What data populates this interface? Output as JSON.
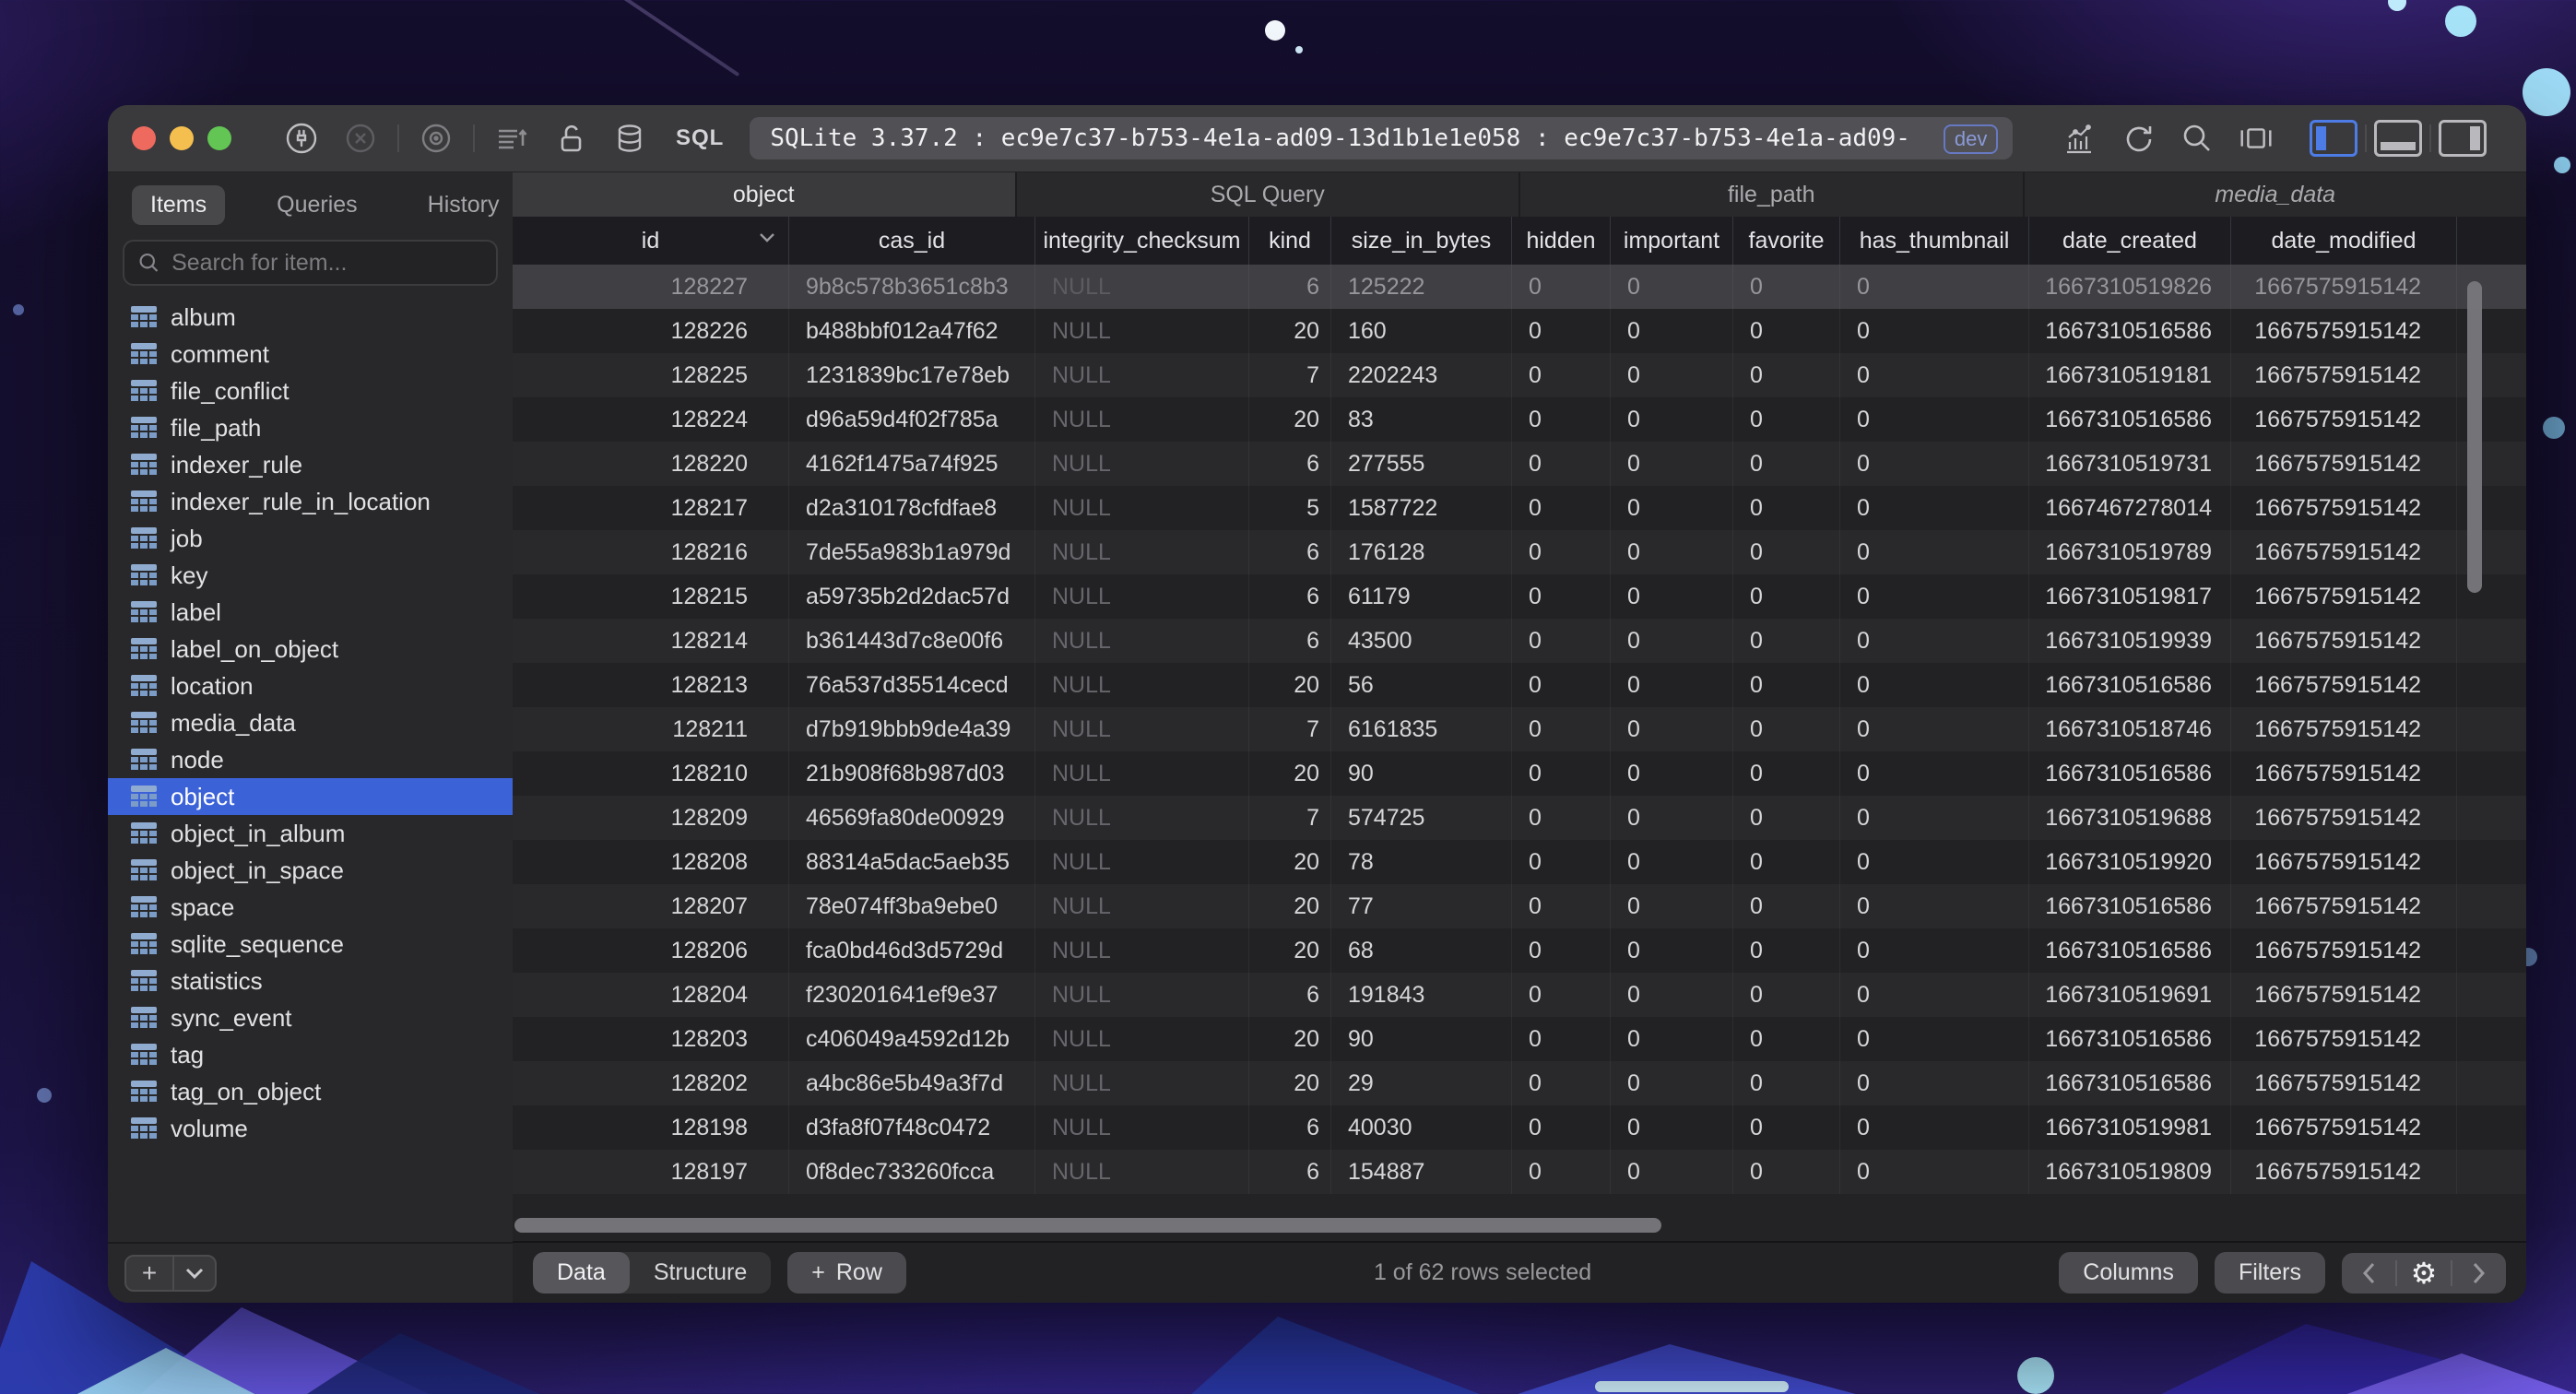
{
  "window": {
    "title": "SQLite 3.37.2 : ec9e7c37-b753-4e1a-ad09-13d1b1e1e058 : ec9e7c37-b753-4e1a-ad09-",
    "dev_badge": "dev",
    "sql_label": "SQL"
  },
  "icons": {
    "plus": "+",
    "gear": "⚙"
  },
  "sidebar": {
    "tabs": [
      {
        "label": "Items",
        "active": true
      },
      {
        "label": "Queries",
        "active": false
      },
      {
        "label": "History",
        "active": false
      }
    ],
    "search_placeholder": "Search for item...",
    "selected_item": "object",
    "items": [
      "album",
      "comment",
      "file_conflict",
      "file_path",
      "indexer_rule",
      "indexer_rule_in_location",
      "job",
      "key",
      "label",
      "label_on_object",
      "location",
      "media_data",
      "node",
      "object",
      "object_in_album",
      "object_in_space",
      "space",
      "sqlite_sequence",
      "statistics",
      "sync_event",
      "tag",
      "tag_on_object",
      "volume"
    ]
  },
  "main": {
    "tabs": [
      {
        "label": "object",
        "active": true,
        "italic": false
      },
      {
        "label": "SQL Query",
        "active": false,
        "italic": false
      },
      {
        "label": "file_path",
        "active": false,
        "italic": false
      },
      {
        "label": "media_data",
        "active": false,
        "italic": true
      }
    ],
    "table": {
      "columns": [
        "id",
        "cas_id",
        "integrity_checksum",
        "kind",
        "size_in_bytes",
        "hidden",
        "important",
        "favorite",
        "has_thumbnail",
        "date_created",
        "date_modified"
      ],
      "selected_row_index": 0,
      "rows": [
        [
          "128227",
          "9b8c578b3651c8b3",
          "NULL",
          "6",
          "125222",
          "0",
          "0",
          "0",
          "0",
          "1667310519826",
          "1667575915142"
        ],
        [
          "128226",
          "b488bbf012a47f62",
          "NULL",
          "20",
          "160",
          "0",
          "0",
          "0",
          "0",
          "1667310516586",
          "1667575915142"
        ],
        [
          "128225",
          "1231839bc17e78eb",
          "NULL",
          "7",
          "2202243",
          "0",
          "0",
          "0",
          "0",
          "1667310519181",
          "1667575915142"
        ],
        [
          "128224",
          "d96a59d4f02f785a",
          "NULL",
          "20",
          "83",
          "0",
          "0",
          "0",
          "0",
          "1667310516586",
          "1667575915142"
        ],
        [
          "128220",
          "4162f1475a74f925",
          "NULL",
          "6",
          "277555",
          "0",
          "0",
          "0",
          "0",
          "1667310519731",
          "1667575915142"
        ],
        [
          "128217",
          "d2a310178cfdfae8",
          "NULL",
          "5",
          "1587722",
          "0",
          "0",
          "0",
          "0",
          "1667467278014",
          "1667575915142"
        ],
        [
          "128216",
          "7de55a983b1a979d",
          "NULL",
          "6",
          "176128",
          "0",
          "0",
          "0",
          "0",
          "1667310519789",
          "1667575915142"
        ],
        [
          "128215",
          "a59735b2d2dac57d",
          "NULL",
          "6",
          "61179",
          "0",
          "0",
          "0",
          "0",
          "1667310519817",
          "1667575915142"
        ],
        [
          "128214",
          "b361443d7c8e00f6",
          "NULL",
          "6",
          "43500",
          "0",
          "0",
          "0",
          "0",
          "1667310519939",
          "1667575915142"
        ],
        [
          "128213",
          "76a537d35514cecd",
          "NULL",
          "20",
          "56",
          "0",
          "0",
          "0",
          "0",
          "1667310516586",
          "1667575915142"
        ],
        [
          "128211",
          "d7b919bbb9de4a39",
          "NULL",
          "7",
          "6161835",
          "0",
          "0",
          "0",
          "0",
          "1667310518746",
          "1667575915142"
        ],
        [
          "128210",
          "21b908f68b987d03",
          "NULL",
          "20",
          "90",
          "0",
          "0",
          "0",
          "0",
          "1667310516586",
          "1667575915142"
        ],
        [
          "128209",
          "46569fa80de00929",
          "NULL",
          "7",
          "574725",
          "0",
          "0",
          "0",
          "0",
          "1667310519688",
          "1667575915142"
        ],
        [
          "128208",
          "88314a5dac5aeb35",
          "NULL",
          "20",
          "78",
          "0",
          "0",
          "0",
          "0",
          "1667310519920",
          "1667575915142"
        ],
        [
          "128207",
          "78e074ff3ba9ebe0",
          "NULL",
          "20",
          "77",
          "0",
          "0",
          "0",
          "0",
          "1667310516586",
          "1667575915142"
        ],
        [
          "128206",
          "fca0bd46d3d5729d",
          "NULL",
          "20",
          "68",
          "0",
          "0",
          "0",
          "0",
          "1667310516586",
          "1667575915142"
        ],
        [
          "128204",
          "f230201641ef9e37",
          "NULL",
          "6",
          "191843",
          "0",
          "0",
          "0",
          "0",
          "1667310519691",
          "1667575915142"
        ],
        [
          "128203",
          "c406049a4592d12b",
          "NULL",
          "20",
          "90",
          "0",
          "0",
          "0",
          "0",
          "1667310516586",
          "1667575915142"
        ],
        [
          "128202",
          "a4bc86e5b49a3f7d",
          "NULL",
          "20",
          "29",
          "0",
          "0",
          "0",
          "0",
          "1667310516586",
          "1667575915142"
        ],
        [
          "128198",
          "d3fa8f07f48c0472",
          "NULL",
          "6",
          "40030",
          "0",
          "0",
          "0",
          "0",
          "1667310519981",
          "1667575915142"
        ],
        [
          "128197",
          "0f8dec733260fcca",
          "NULL",
          "6",
          "154887",
          "0",
          "0",
          "0",
          "0",
          "1667310519809",
          "1667575915142"
        ]
      ]
    },
    "footer": {
      "view_tabs": [
        {
          "label": "Data",
          "active": true
        },
        {
          "label": "Structure",
          "active": false
        }
      ],
      "add_row_label": "Row",
      "status": "1 of 62 rows selected",
      "columns_label": "Columns",
      "filters_label": "Filters"
    }
  }
}
